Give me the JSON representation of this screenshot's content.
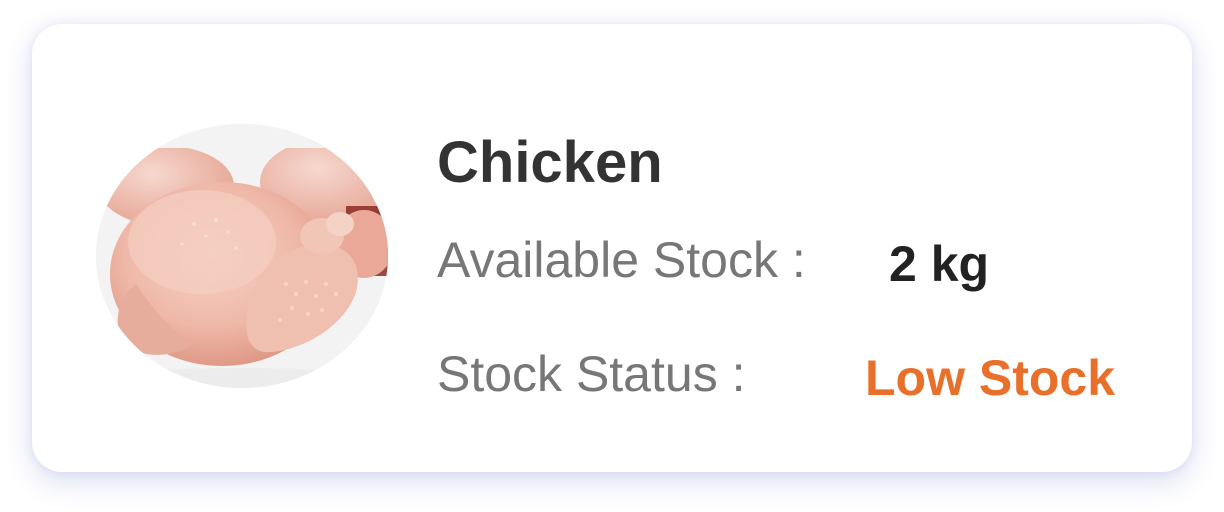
{
  "product": {
    "name": "Chicken",
    "image_alt": "raw-chicken-image"
  },
  "stock": {
    "available_label": "Available Stock :",
    "available_value": "2 kg",
    "status_label": "Stock Status :",
    "status_value": "Low Stock"
  },
  "colors": {
    "status_low": "#e8702a",
    "card_shadow": "#3c50be"
  }
}
